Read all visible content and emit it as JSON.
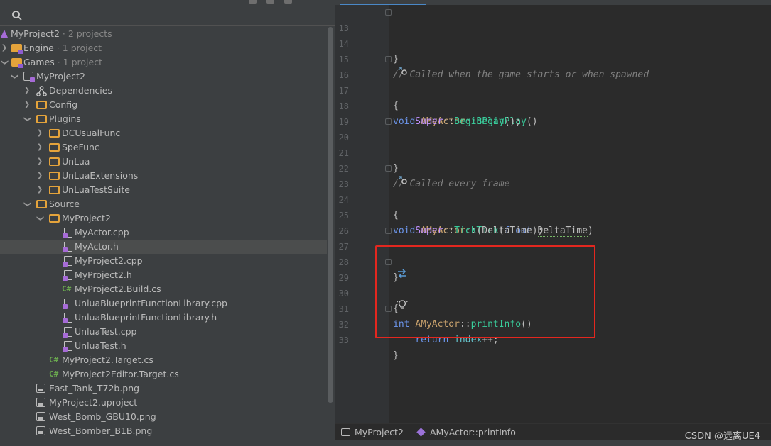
{
  "explorer": {
    "search_placeholder": "",
    "items": [
      {
        "label": "MyProject2",
        "suffix": " · 2 projects"
      },
      {
        "label": "Engine",
        "suffix": " · 1 project"
      },
      {
        "label": "Games",
        "suffix": " · 1 project"
      },
      {
        "label": "MyProject2"
      },
      {
        "label": "Dependencies"
      },
      {
        "label": "Config"
      },
      {
        "label": "Plugins"
      },
      {
        "label": "DCUsualFunc"
      },
      {
        "label": "SpeFunc"
      },
      {
        "label": "UnLua"
      },
      {
        "label": "UnLuaExtensions"
      },
      {
        "label": "UnLuaTestSuite"
      },
      {
        "label": "Source"
      },
      {
        "label": "MyProject2"
      },
      {
        "label": "MyActor.cpp"
      },
      {
        "label": "MyActor.h"
      },
      {
        "label": "MyProject2.cpp"
      },
      {
        "label": "MyProject2.h"
      },
      {
        "label": "MyProject2.Build.cs",
        "badge": "C#"
      },
      {
        "label": "UnluaBlueprintFunctionLibrary.cpp"
      },
      {
        "label": "UnluaBlueprintFunctionLibrary.h"
      },
      {
        "label": "UnluaTest.cpp"
      },
      {
        "label": "UnluaTest.h"
      },
      {
        "label": "MyProject2.Target.cs",
        "badge": "C#"
      },
      {
        "label": "MyProject2Editor.Target.cs",
        "badge": "C#"
      },
      {
        "label": "East_Tank_T72b.png"
      },
      {
        "label": "MyProject2.uproject"
      },
      {
        "label": "West_Bomb_GBU10.png"
      },
      {
        "label": "West_Bomber_B1B.png"
      }
    ]
  },
  "editor": {
    "lines": [
      {
        "n": "13",
        "t": "}"
      },
      {
        "n": "14",
        "t": ""
      },
      {
        "n": "15",
        "t": "// Called when the game starts or when spawned"
      },
      {
        "n": "16",
        "a": "void ",
        "b": "AMyActor",
        "c": "::",
        "d": "BeginPlay",
        "e": "()"
      },
      {
        "n": "17",
        "t": "{"
      },
      {
        "n": "18",
        "a": "    Super",
        "c": "::",
        "d": "BeginPlay",
        "e": "();"
      },
      {
        "n": "19",
        "t": ""
      },
      {
        "n": "20",
        "t": "}"
      },
      {
        "n": "21",
        "t": ""
      },
      {
        "n": "22",
        "t": "// Called every frame"
      },
      {
        "n": "23",
        "a": "void ",
        "b": "AMyActor",
        "c": "::",
        "d": "Tick",
        "e": "(",
        "f": "float ",
        "g": "DeltaTime",
        "h": ")"
      },
      {
        "n": "24",
        "t": "{"
      },
      {
        "n": "25",
        "a": "    Super",
        "c": "::",
        "d": "Tick",
        "e": "(DeltaTime);"
      },
      {
        "n": "26",
        "t": ""
      },
      {
        "n": "27",
        "t": "}"
      },
      {
        "n": "28",
        "t": ""
      },
      {
        "n": "29",
        "a": "int ",
        "b": "AMyActor",
        "c": "::",
        "d": "printInfo",
        "e": "()"
      },
      {
        "n": "30",
        "t": "{"
      },
      {
        "n": "31",
        "a": "    return ",
        "b": "index",
        "c": "++;"
      },
      {
        "n": "32",
        "t": "}"
      },
      {
        "n": "33",
        "t": ""
      }
    ]
  },
  "breadcrumb": {
    "project": "MyProject2",
    "symbol": "AMyActor::printInfo"
  },
  "watermark": "CSDN @远离UE4",
  "colors": {
    "highlight_box": "#e3271f",
    "folder": "#e4a33b",
    "keyword": "#6c95eb",
    "function": "#39cc9b"
  }
}
